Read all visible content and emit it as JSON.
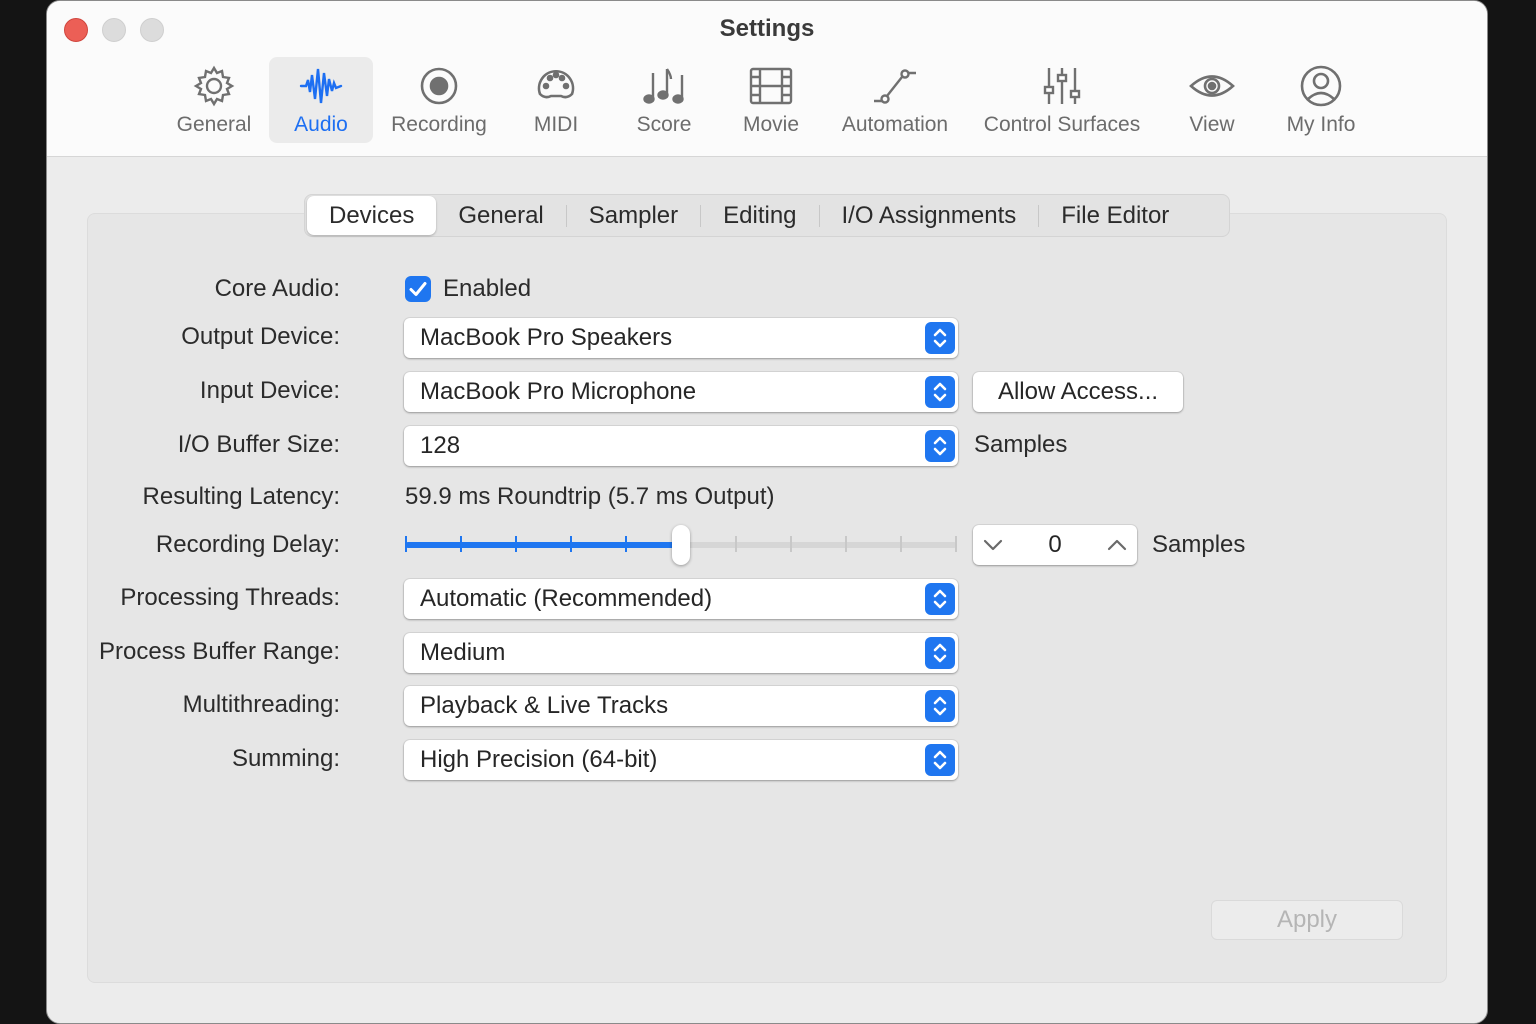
{
  "window": {
    "title": "Settings"
  },
  "toolbar": {
    "items": [
      {
        "label": "General",
        "icon": "gear-icon"
      },
      {
        "label": "Audio",
        "icon": "waveform-icon",
        "selected": true
      },
      {
        "label": "Recording",
        "icon": "record-icon"
      },
      {
        "label": "MIDI",
        "icon": "midi-connector-icon"
      },
      {
        "label": "Score",
        "icon": "music-notes-icon"
      },
      {
        "label": "Movie",
        "icon": "film-icon"
      },
      {
        "label": "Automation",
        "icon": "automation-curve-icon"
      },
      {
        "label": "Control Surfaces",
        "icon": "faders-icon"
      },
      {
        "label": "View",
        "icon": "eye-icon"
      },
      {
        "label": "My Info",
        "icon": "person-circle-icon"
      }
    ]
  },
  "tabs": [
    {
      "label": "Devices",
      "active": true
    },
    {
      "label": "General"
    },
    {
      "label": "Sampler"
    },
    {
      "label": "Editing"
    },
    {
      "label": "I/O Assignments"
    },
    {
      "label": "File Editor"
    }
  ],
  "form": {
    "core_audio": {
      "label": "Core Audio:",
      "checkbox_label": "Enabled",
      "checked": true
    },
    "output_device": {
      "label": "Output Device:",
      "value": "MacBook Pro Speakers"
    },
    "input_device": {
      "label": "Input Device:",
      "value": "MacBook Pro Microphone",
      "button": "Allow Access..."
    },
    "buffer_size": {
      "label": "I/O Buffer Size:",
      "value": "128",
      "unit": "Samples"
    },
    "latency": {
      "label": "Resulting Latency:",
      "value": "59.9 ms Roundtrip (5.7 ms Output)"
    },
    "recording_delay": {
      "label": "Recording Delay:",
      "value": "0",
      "unit": "Samples",
      "slider_fraction": 0.5
    },
    "processing_threads": {
      "label": "Processing Threads:",
      "value": "Automatic (Recommended)"
    },
    "process_buffer_range": {
      "label": "Process Buffer Range:",
      "value": "Medium"
    },
    "multithreading": {
      "label": "Multithreading:",
      "value": "Playback & Live Tracks"
    },
    "summing": {
      "label": "Summing:",
      "value": "High Precision (64-bit)"
    }
  },
  "apply_button": {
    "label": "Apply",
    "enabled": false
  },
  "colors": {
    "accent": "#1f76f0",
    "close": "#ec5f56"
  }
}
